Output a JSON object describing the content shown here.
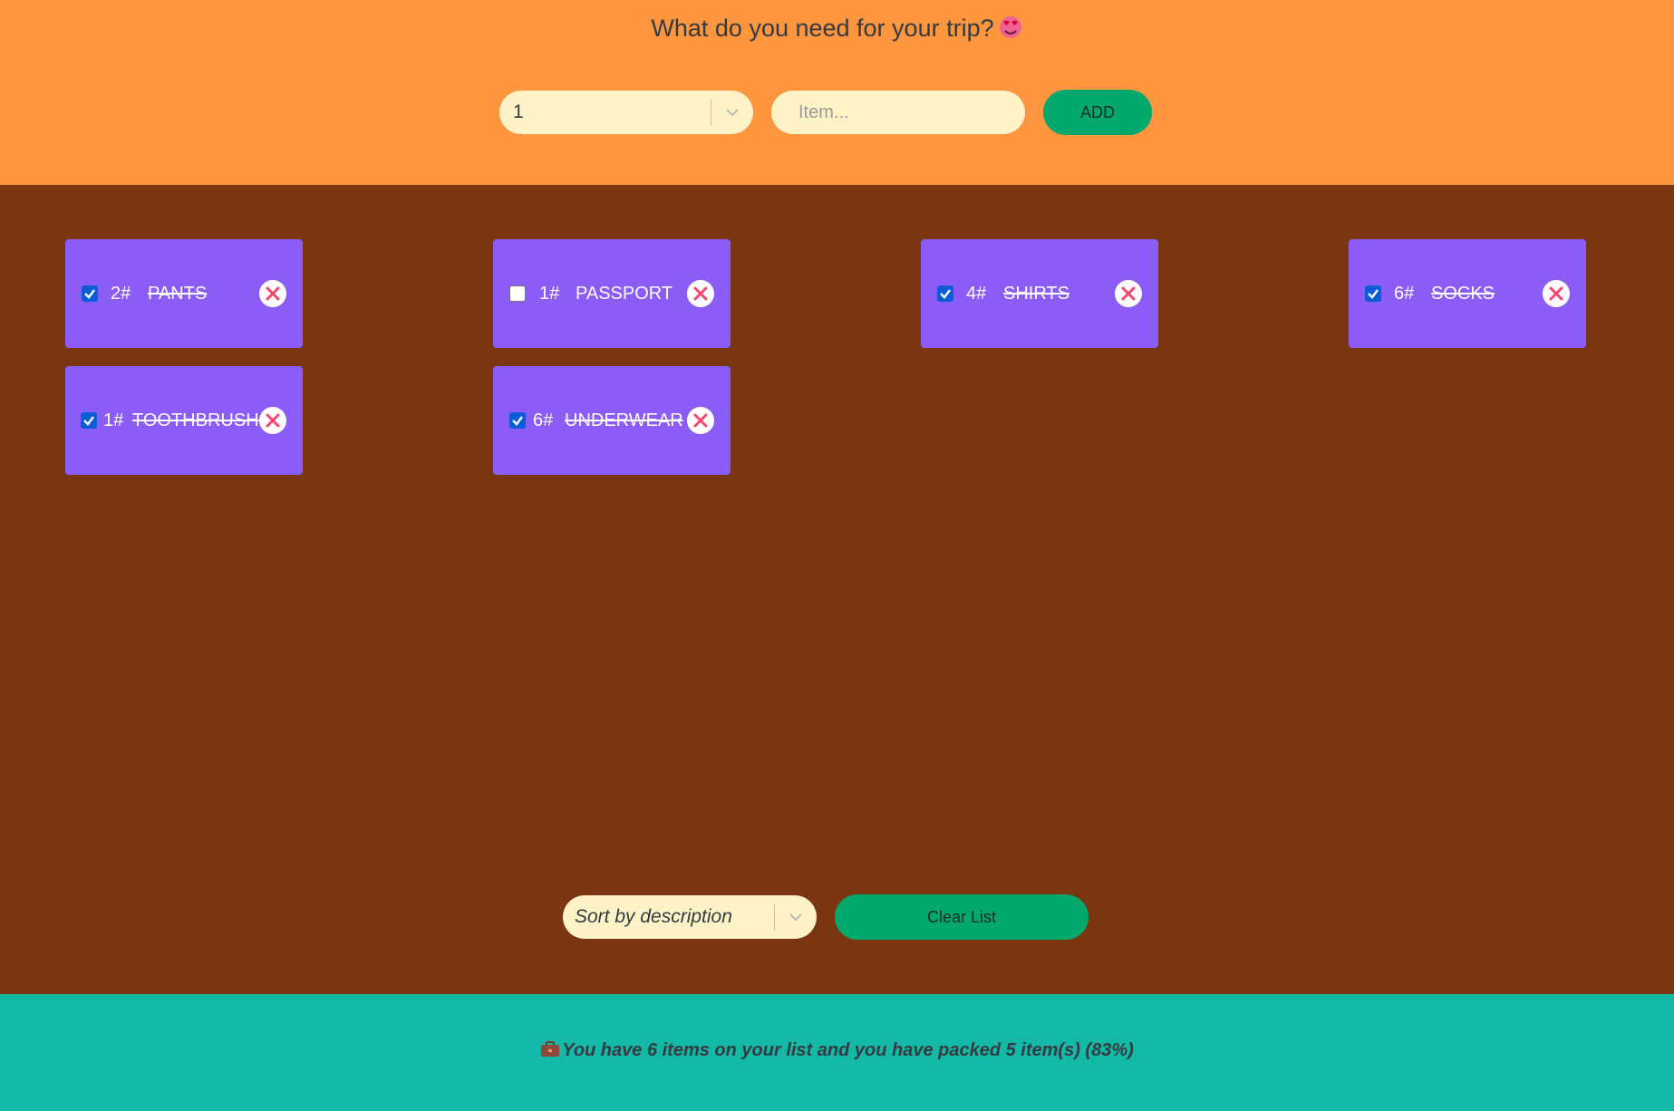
{
  "header": {
    "title": "What do you need for your trip?",
    "title_icon": "smiling-face-with-heart-eyes-icon"
  },
  "form": {
    "quantity_value": "1",
    "item_placeholder": "Item...",
    "add_label": "ADD"
  },
  "items": [
    {
      "quantity": "2#",
      "description": "PANTS",
      "packed": true
    },
    {
      "quantity": "1#",
      "description": "PASSPORT",
      "packed": false
    },
    {
      "quantity": "4#",
      "description": "SHIRTS",
      "packed": true
    },
    {
      "quantity": "6#",
      "description": "SOCKS",
      "packed": true
    },
    {
      "quantity": "1#",
      "description": "TOOTHBRUSH",
      "packed": true
    },
    {
      "quantity": "6#",
      "description": "UNDERWEAR",
      "packed": true
    }
  ],
  "actions": {
    "sort_value": "Sort by description",
    "clear_label": "Clear List"
  },
  "stats": {
    "icon": "briefcase-icon",
    "text": "You have 6 items on your list and you have packed 5 item(s) (83%)"
  },
  "colors": {
    "header_bg": "#fd963f",
    "main_bg": "#7a3610",
    "card_bg": "#8b5cf6",
    "button_bg": "#00a86b",
    "footer_bg": "#14b8a6",
    "input_bg": "#fef3c7",
    "delete_icon": "#f5466e"
  }
}
